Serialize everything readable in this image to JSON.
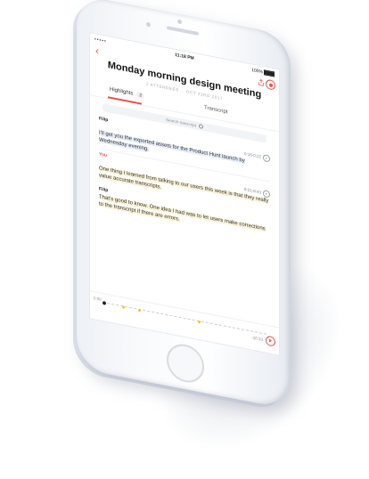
{
  "status_bar": {
    "signal": "••••• ",
    "time": "11:18 PM",
    "battery": "100%"
  },
  "meeting": {
    "title": "Monday morning design meeting",
    "attendees": "2 ATTENDEES",
    "date": "OCT 23RD 2017"
  },
  "tabs": [
    {
      "label": "Highlights",
      "count": "2",
      "active": true
    },
    {
      "label": "Transcript",
      "active": false
    }
  ],
  "search": {
    "placeholder": "Search transcript"
  },
  "transcript": [
    {
      "speaker": "Filip",
      "time": "0:16-0:22",
      "text": "I’ll get you the exported assets for the Product Hunt launch by Wednesday evening.",
      "highlight": "blue"
    },
    {
      "speaker": "You",
      "time": "8:21-8:43",
      "text": "One thing I learned from talking to our users this week is that they really value accurate transcripts.",
      "highlight": "yellow"
    },
    {
      "speaker": "Filip",
      "time": "",
      "text": "That’s good to know. One idea I had was to let users make corrections to the transcript if there are errors.",
      "highlight": "yellow"
    }
  ],
  "player": {
    "elapsed": "0:00",
    "remaining": "-26:33",
    "progress": 0.0,
    "markers": [
      0.12,
      0.22,
      0.58
    ]
  },
  "colors": {
    "accent": "#e2574c",
    "highlight_blue": "#e7eefb",
    "highlight_yellow": "#fbf4d9",
    "marker": "#f3c623"
  },
  "icons": [
    "back-icon",
    "share-icon",
    "record-icon",
    "search-icon",
    "play-icon"
  ]
}
